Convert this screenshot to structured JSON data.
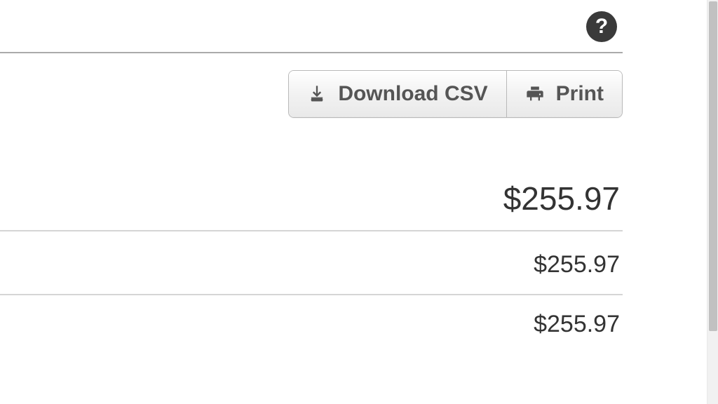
{
  "toolbar": {
    "download_csv_label": "Download CSV",
    "print_label": "Print"
  },
  "help": {
    "symbol": "?"
  },
  "amounts": {
    "line1": "$255.97",
    "line2": "$255.97",
    "line3": "$255.97"
  }
}
